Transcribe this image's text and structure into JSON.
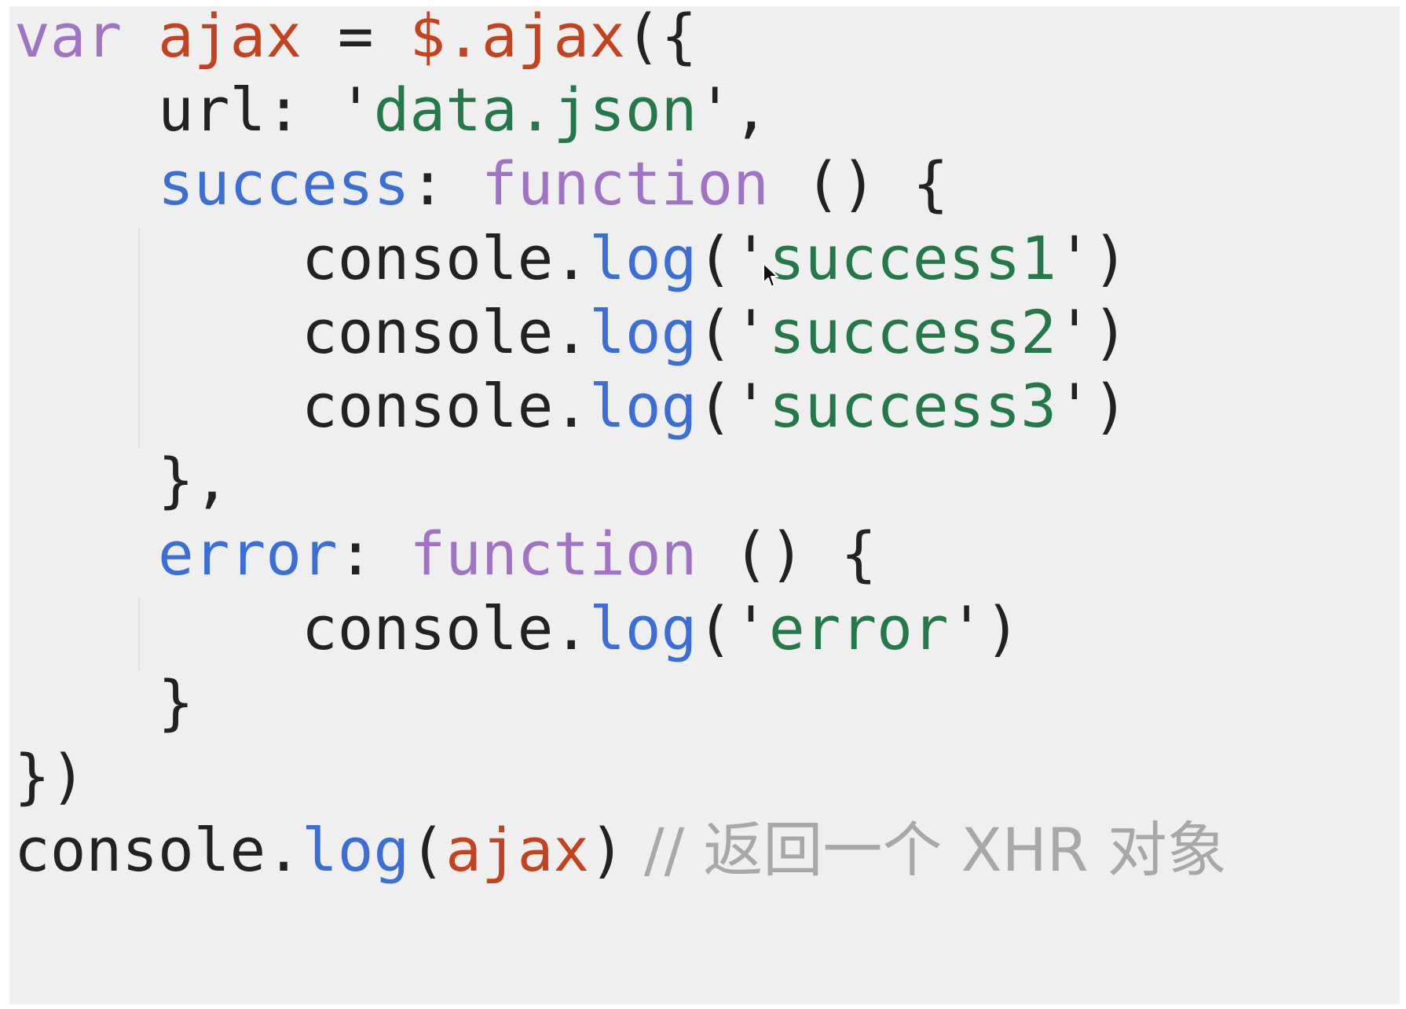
{
  "colors": {
    "background": "#efefef",
    "keyword": "#a074c4",
    "variable": "#c4421e",
    "property": "#3b6fd6",
    "string": "#24784a",
    "text": "#222222",
    "comment": "#a8a8a8"
  },
  "code": {
    "l1": {
      "kw": "var",
      "sp1": " ",
      "name": "ajax",
      "op": " = ",
      "lib": "$.ajax",
      "open": "({"
    },
    "l2": {
      "indent": "    ",
      "key": "url",
      "colon": ": ",
      "q1": "'",
      "val": "data.json",
      "q2": "'",
      "comma": ","
    },
    "l3": {
      "indent": "    ",
      "key": "success",
      "colon": ": ",
      "kw": "function",
      "rest": " () {"
    },
    "l4": {
      "indent": "        ",
      "obj": "console.",
      "fn": "log",
      "open": "(",
      "q1": "'",
      "val": "success1",
      "q2": "'",
      "close": ")"
    },
    "l5": {
      "indent": "        ",
      "obj": "console.",
      "fn": "log",
      "open": "(",
      "q1": "'",
      "val": "success2",
      "q2": "'",
      "close": ")"
    },
    "l6": {
      "indent": "        ",
      "obj": "console.",
      "fn": "log",
      "open": "(",
      "q1": "'",
      "val": "success3",
      "q2": "'",
      "close": ")"
    },
    "l7": {
      "indent": "    ",
      "text": "},"
    },
    "l8": {
      "indent": "    ",
      "key": "error",
      "colon": ": ",
      "kw": "function",
      "rest": " () {"
    },
    "l9": {
      "indent": "        ",
      "obj": "console.",
      "fn": "log",
      "open": "(",
      "q1": "'",
      "val": "error",
      "q2": "'",
      "close": ")"
    },
    "l10": {
      "indent": "    ",
      "text": "}"
    },
    "l11": {
      "text": "})"
    },
    "l12": {
      "obj": "console.",
      "fn": "log",
      "open": "(",
      "arg": "ajax",
      "close": ")",
      "comment": " // 返回一个 XHR 对象"
    }
  },
  "icons": {
    "cursor": "mouse-pointer-icon"
  }
}
